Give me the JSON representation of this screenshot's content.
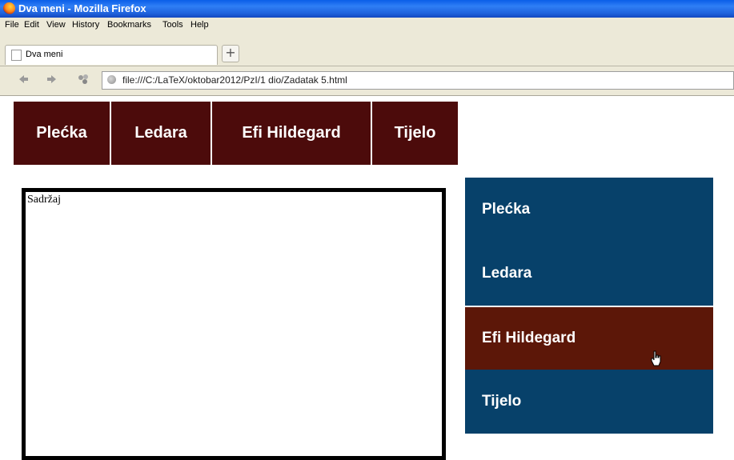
{
  "window": {
    "title": "Dva meni - Mozilla Firefox"
  },
  "menu": [
    "File",
    "Edit",
    "View",
    "History",
    "Bookmarks",
    "Tools",
    "Help"
  ],
  "tab": {
    "label": "Dva meni",
    "new_tab_label": "+"
  },
  "nav": {
    "back_icon": "back-arrow-icon",
    "forward_icon": "forward-arrow-icon",
    "url": "file:///C:/LaTeX/oktobar2012/PzI/1 dio/Zadatak 5.html"
  },
  "top_menu": [
    "Plećka",
    "Ledara",
    "Efi Hildegard",
    "Tijelo"
  ],
  "content": {
    "text": "Sadržaj"
  },
  "side_menu": {
    "items": [
      "Plećka",
      "Ledara",
      "Efi Hildegard",
      "Tijelo"
    ],
    "active_index": 2
  },
  "colors": {
    "top_menu_bg": "#4c0b0b",
    "side_menu_bg": "#07416a",
    "side_active_bg": "#5c1708"
  }
}
